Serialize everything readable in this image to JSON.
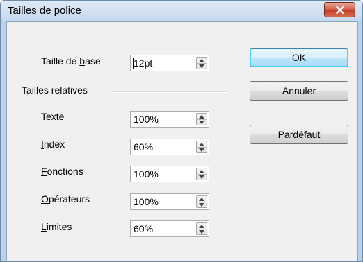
{
  "dialog": {
    "title": "Tailles de police",
    "close_icon": "close-x-icon"
  },
  "base_size": {
    "label_pre": "Taille de ",
    "label_u": "b",
    "label_post": "ase",
    "value": "12pt"
  },
  "relative": {
    "heading": "Tailles relatives",
    "rows": [
      {
        "pre": "Te",
        "u": "x",
        "post": "te",
        "value": "100%"
      },
      {
        "pre": "",
        "u": "I",
        "post": "ndex",
        "value": "60%"
      },
      {
        "pre": "",
        "u": "F",
        "post": "onctions",
        "value": "100%"
      },
      {
        "pre": "",
        "u": "O",
        "post": "pérateurs",
        "value": "100%"
      },
      {
        "pre": "",
        "u": "L",
        "post": "imites",
        "value": "60%"
      }
    ]
  },
  "buttons": {
    "ok": "OK",
    "cancel": "Annuler",
    "default_pre": "Par ",
    "default_u": "d",
    "default_post": "éfaut"
  },
  "icons": {
    "spin": "spin-arrows-icon"
  }
}
